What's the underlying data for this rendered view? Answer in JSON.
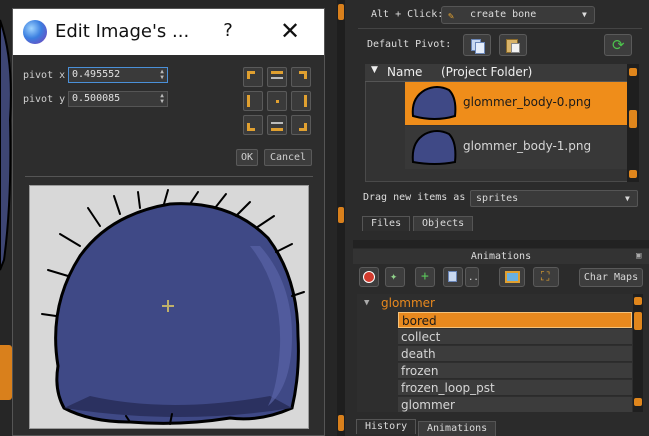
{
  "dialog": {
    "title": "Edit Image's ...",
    "help": "?",
    "close": "✕",
    "pivot_x_label": "pivot x",
    "pivot_x_value": "0.495552",
    "pivot_y_label": "pivot y",
    "pivot_y_value": "0.500085",
    "ok_label": "OK",
    "cancel_label": "Cancel"
  },
  "toolbar": {
    "alt_click_label": "Alt + Click:",
    "tool_value": "create bone",
    "default_pivot_label": "Default Pivot:"
  },
  "files": {
    "columns": [
      "Name",
      "(Project Folder)"
    ],
    "items": [
      {
        "label": "glommer_body-0.png",
        "selected": true
      },
      {
        "label": "glommer_body-1.png",
        "selected": false
      }
    ],
    "drag_label": "Drag new items as",
    "drag_value": "sprites",
    "tabs": [
      "Files",
      "Objects"
    ],
    "active_tab": "Objects"
  },
  "animations": {
    "title": "Animations",
    "char_maps_label": "Char Maps",
    "group": "glommer",
    "items": [
      "bored",
      "collect",
      "death",
      "frozen",
      "frozen_loop_pst",
      "glommer"
    ],
    "selected": "bored",
    "bottom_tabs": [
      "History",
      "Animations"
    ],
    "active_tab": "Animations"
  },
  "colors": {
    "accent": "#e8891e",
    "panel": "#2b2b2b",
    "creature": "#404a84"
  },
  "icons": [
    "globe-icon",
    "help-icon",
    "close-icon",
    "pencil-icon",
    "copy-icon",
    "paste-icon",
    "refresh-icon",
    "delete-icon",
    "new-anim-icon",
    "add-icon",
    "duplicate-icon",
    "image-icon",
    "fit-icon",
    "chevron-down-icon"
  ]
}
